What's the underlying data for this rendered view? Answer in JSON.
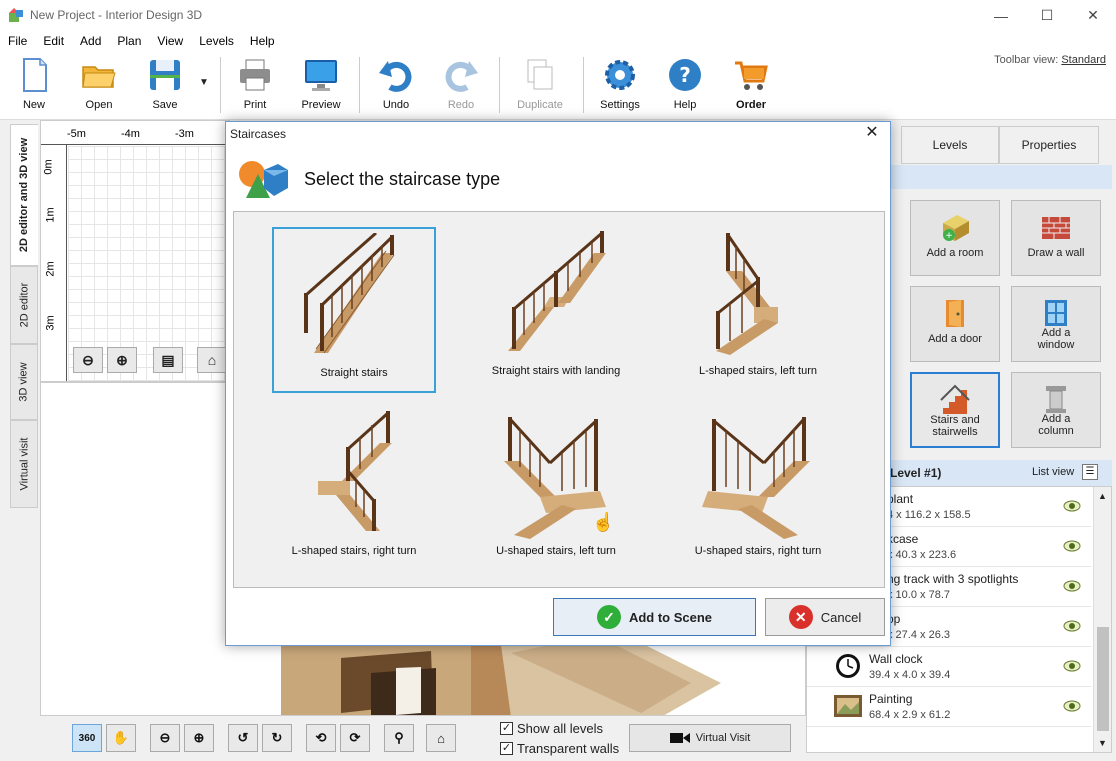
{
  "window": {
    "title": "New Project - Interior Design 3D"
  },
  "menu": [
    "File",
    "Edit",
    "Add",
    "Plan",
    "View",
    "Levels",
    "Help"
  ],
  "toolbar": {
    "items": [
      {
        "label": "New",
        "icon": "new-document-icon"
      },
      {
        "label": "Open",
        "icon": "folder-icon"
      },
      {
        "label": "Save",
        "icon": "save-icon"
      },
      {
        "label": "Print",
        "icon": "printer-icon"
      },
      {
        "label": "Preview",
        "icon": "monitor-icon"
      },
      {
        "label": "Undo",
        "icon": "undo-icon"
      },
      {
        "label": "Redo",
        "icon": "redo-icon"
      },
      {
        "label": "Duplicate",
        "icon": "duplicate-icon"
      },
      {
        "label": "Settings",
        "icon": "gear-icon"
      },
      {
        "label": "Help",
        "icon": "help-icon"
      },
      {
        "label": "Order",
        "icon": "cart-icon"
      }
    ],
    "view_label": "Toolbar view:",
    "view_value": "Standard"
  },
  "left_tabs": [
    "2D editor and 3D view",
    "2D editor",
    "3D view",
    "Virtual visit"
  ],
  "ruler": {
    "top": [
      "-5m",
      "-4m",
      "-3m"
    ],
    "left": [
      "0m",
      "1m",
      "2m",
      "3m"
    ]
  },
  "bottom": {
    "show_all_levels": "Show all levels",
    "transparent_walls": "Transparent walls",
    "virtual_visit": "Virtual Visit",
    "rotate_360": "360"
  },
  "right_panel": {
    "tabs": [
      "Levels",
      "Properties"
    ],
    "tiles": [
      {
        "label": "Add a room",
        "icon": "room-icon"
      },
      {
        "label": "Draw a wall",
        "icon": "brick-wall-icon"
      },
      {
        "label": "Add a door",
        "icon": "door-icon"
      },
      {
        "label": "Add a\nwindow",
        "icon": "window-icon"
      },
      {
        "label": "Stairs and\nstairwells",
        "icon": "stairs-icon"
      },
      {
        "label": "Add a\ncolumn",
        "icon": "column-icon"
      }
    ],
    "objects_header": "s (Level #1)",
    "list_view": "List view",
    "objects": [
      {
        "name": "plant",
        "dims": "4 x 116.2 x 158.5"
      },
      {
        "name": "kcase",
        "dims": "x 40.3 x 223.6"
      },
      {
        "name": "ng track with 3 spotlights",
        "dims": "x 10.0 x 78.7"
      },
      {
        "name": "op",
        "dims": "x 27.4 x 26.3"
      },
      {
        "name": "Wall clock",
        "dims": "39.4 x 4.0 x 39.4"
      },
      {
        "name": "Painting",
        "dims": "68.4 x 2.9 x 61.2"
      }
    ]
  },
  "dialog": {
    "title": "Staircases",
    "heading": "Select the staircase type",
    "options": [
      "Straight stairs",
      "Straight stairs with landing",
      "L-shaped stairs, left turn",
      "L-shaped stairs, right turn",
      "U-shaped stairs, left turn",
      "U-shaped stairs, right turn"
    ],
    "add_button": "Add to Scene",
    "cancel_button": "Cancel"
  },
  "colors": {
    "accent": "#2a7fd4",
    "selection": "#3aa0d8",
    "ok_green": "#2fae3a",
    "cancel_red": "#d9302b",
    "wood": "#7a4a2a"
  }
}
